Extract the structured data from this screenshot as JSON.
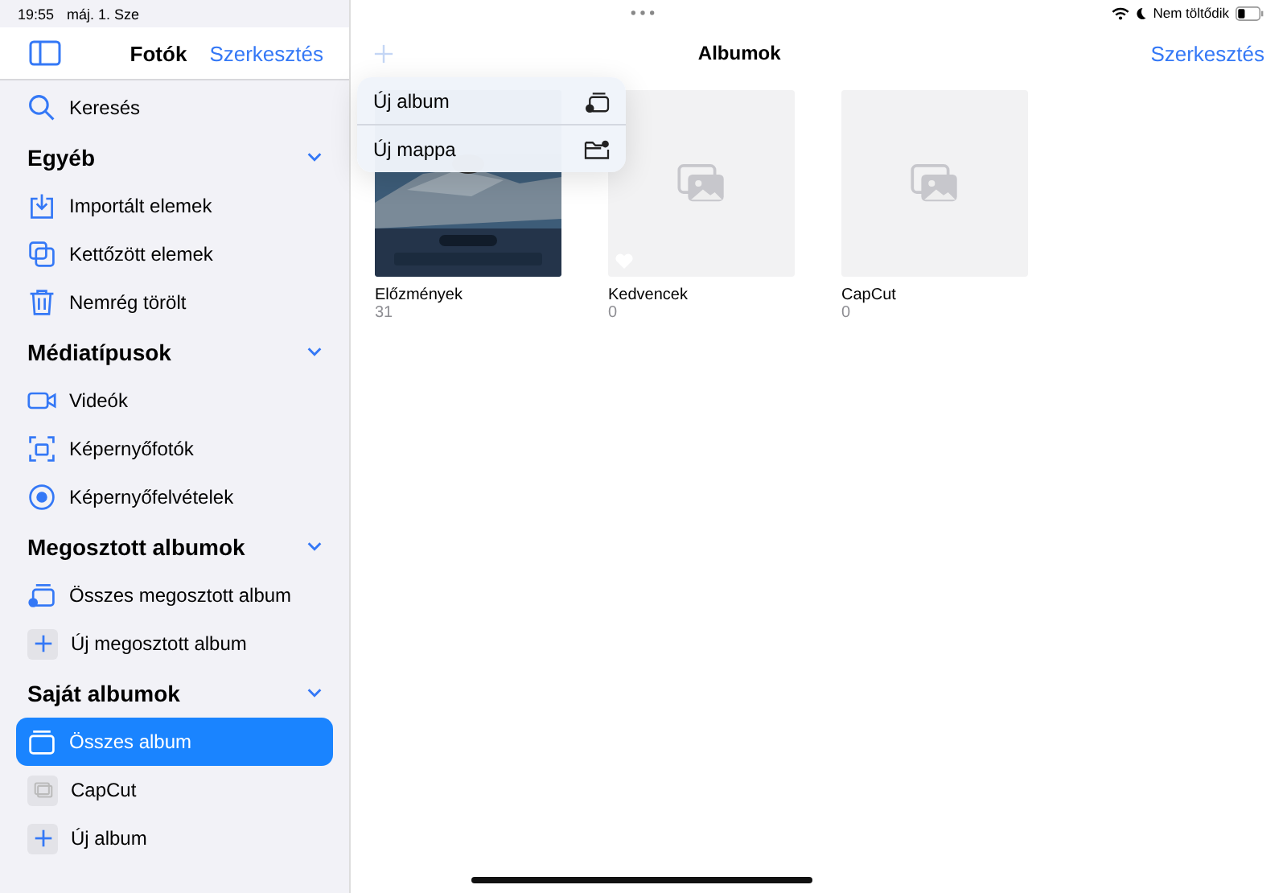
{
  "status_bar": {
    "time": "19:55",
    "date": "máj. 1. Sze",
    "battery_text": "Nem töltődik"
  },
  "sidebar": {
    "title": "Fotók",
    "edit": "Szerkesztés",
    "search": {
      "label": "Keresés"
    },
    "sections": [
      {
        "title": "Egyéb",
        "expanded": true,
        "items": [
          {
            "label": "Importált elemek",
            "kind": "import",
            "selected": false
          },
          {
            "label": "Kettőzött elemek",
            "kind": "duplicate",
            "selected": false
          },
          {
            "label": "Nemrég törölt",
            "kind": "trash",
            "selected": false
          }
        ]
      },
      {
        "title": "Médiatípusok",
        "expanded": true,
        "items": [
          {
            "label": "Videók",
            "kind": "video",
            "selected": false
          },
          {
            "label": "Képernyőfotók",
            "kind": "screenshot",
            "selected": false
          },
          {
            "label": "Képernyőfelvételek",
            "kind": "record",
            "selected": false
          }
        ]
      },
      {
        "title": "Megosztott albumok",
        "expanded": true,
        "items": [
          {
            "label": "Összes megosztott album",
            "kind": "shared",
            "selected": false
          },
          {
            "label": "Új megosztott album",
            "kind": "add",
            "selected": false
          }
        ]
      },
      {
        "title": "Saját albumok",
        "expanded": true,
        "items": [
          {
            "label": "Összes album",
            "kind": "albums",
            "selected": true
          },
          {
            "label": "CapCut",
            "kind": "thumb",
            "selected": false
          },
          {
            "label": "Új album",
            "kind": "add",
            "selected": false
          }
        ]
      }
    ]
  },
  "main": {
    "title": "Albumok",
    "edit": "Szerkesztés",
    "albums": [
      {
        "name": "Előzmények",
        "count": "31",
        "kind": "picture"
      },
      {
        "name": "Kedvencek",
        "count": "0",
        "kind": "favorites"
      },
      {
        "name": "CapCut",
        "count": "0",
        "kind": "empty"
      }
    ]
  },
  "menu": {
    "items": [
      {
        "label": "Új album",
        "kind": "album"
      },
      {
        "label": "Új mappa",
        "kind": "folder"
      }
    ]
  }
}
